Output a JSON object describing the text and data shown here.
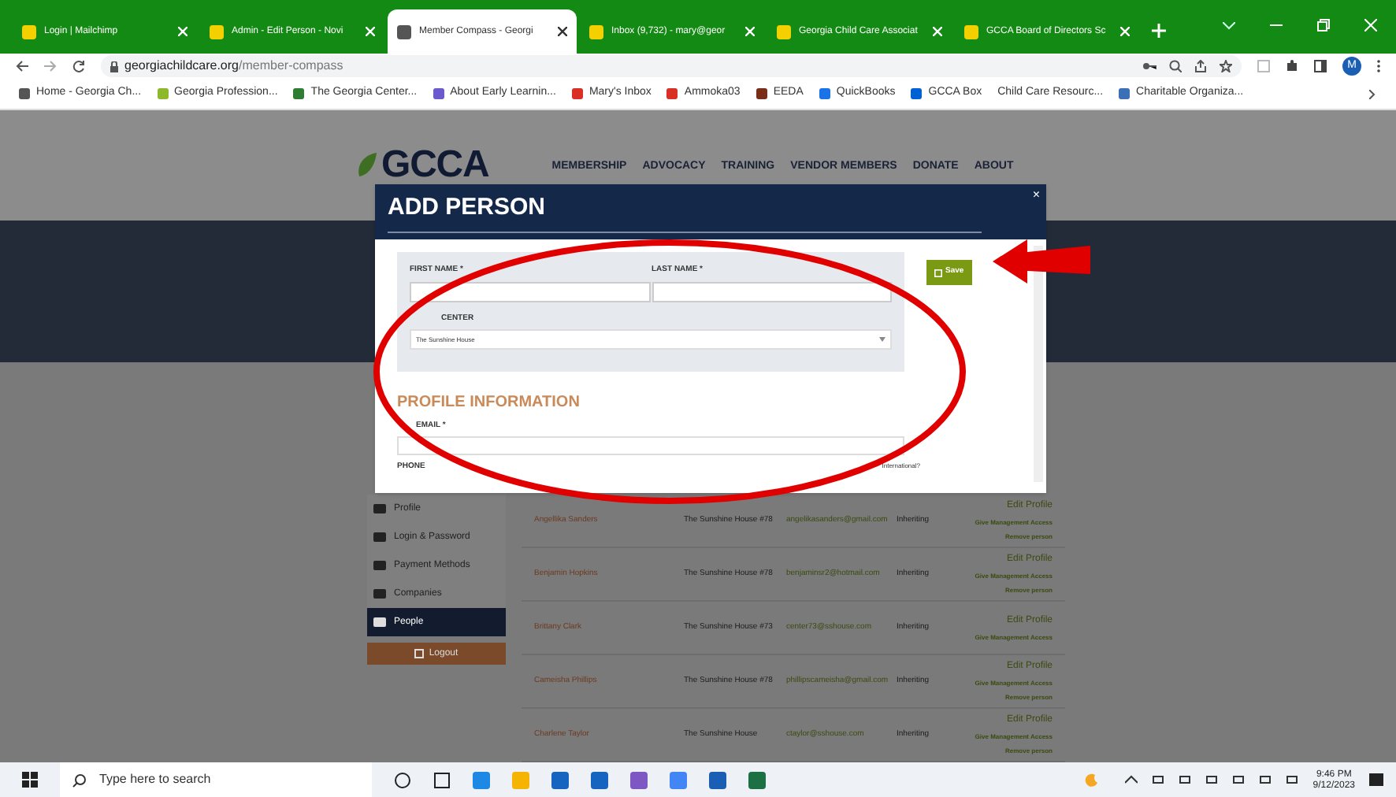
{
  "browser": {
    "tabs": [
      {
        "title": "Login | Mailchimp",
        "selected": false
      },
      {
        "title": "Admin - Edit Person - Novi",
        "selected": false
      },
      {
        "title": "Member Compass - Georgi",
        "selected": true
      },
      {
        "title": "Inbox (9,732) - mary@geor",
        "selected": false
      },
      {
        "title": "Georgia Child Care Associat",
        "selected": false
      },
      {
        "title": "GCCA Board of Directors Sc",
        "selected": false
      }
    ],
    "address_host": "georgiachildcare.org",
    "address_path": "/member-compass",
    "profile_initial": "M",
    "bookmarks": [
      "Home - Georgia Ch...",
      "Georgia Profession...",
      "The Georgia Center...",
      "About Early Learnin...",
      "Mary's Inbox",
      "Ammoka03",
      "EEDA",
      "QuickBooks",
      "GCCA Box",
      "Child Care Resourc...",
      "Charitable Organiza..."
    ]
  },
  "site": {
    "logo": "GCCA",
    "nav": [
      "MEMBERSHIP",
      "ADVOCACY",
      "TRAINING",
      "VENDOR MEMBERS",
      "DONATE",
      "ABOUT"
    ],
    "sidebar": [
      {
        "label": "Profile",
        "selected": false
      },
      {
        "label": "Login & Password",
        "selected": false
      },
      {
        "label": "Payment Methods",
        "selected": false
      },
      {
        "label": "Companies",
        "selected": false
      },
      {
        "label": "People",
        "selected": true
      }
    ],
    "logout": "Logout",
    "people": [
      {
        "name": "Angellika Sanders",
        "center": "The Sunshine House #78",
        "email": "angelikasanders@gmail.com",
        "status": "Inheriting",
        "actions": [
          "Edit Profile",
          "Give Management Access",
          "Remove person"
        ]
      },
      {
        "name": "Benjamin Hopkins",
        "center": "The Sunshine House #78",
        "email": "benjaminsr2@hotmail.com",
        "status": "Inheriting",
        "actions": [
          "Edit Profile",
          "Give Management Access",
          "Remove person"
        ]
      },
      {
        "name": "Brittany Clark",
        "center": "The Sunshine House #73",
        "email": "center73@sshouse.com",
        "status": "Inheriting",
        "actions": [
          "Edit Profile",
          "Give Management Access"
        ]
      },
      {
        "name": "Cameisha Phillips",
        "center": "The Sunshine House #78",
        "email": "phillipscameisha@gmail.com",
        "status": "Inheriting",
        "actions": [
          "Edit Profile",
          "Give Management Access",
          "Remove person"
        ]
      },
      {
        "name": "Charlene Taylor",
        "center": "The Sunshine House",
        "email": "ctaylor@sshouse.com",
        "status": "Inheriting",
        "actions": [
          "Edit Profile",
          "Give Management Access",
          "Remove person"
        ]
      }
    ]
  },
  "modal": {
    "title": "ADD PERSON",
    "close": "×",
    "first_name_label": "FIRST NAME *",
    "last_name_label": "LAST NAME *",
    "center_label": "CENTER",
    "center_value": "The Sunshine House",
    "save": "Save",
    "section": "PROFILE INFORMATION",
    "email_label": "EMAIL *",
    "phone_label": "PHONE",
    "international": "International?"
  },
  "taskbar": {
    "search_placeholder": "Type here to search",
    "time": "9:46 PM",
    "date": "9/12/2023"
  }
}
